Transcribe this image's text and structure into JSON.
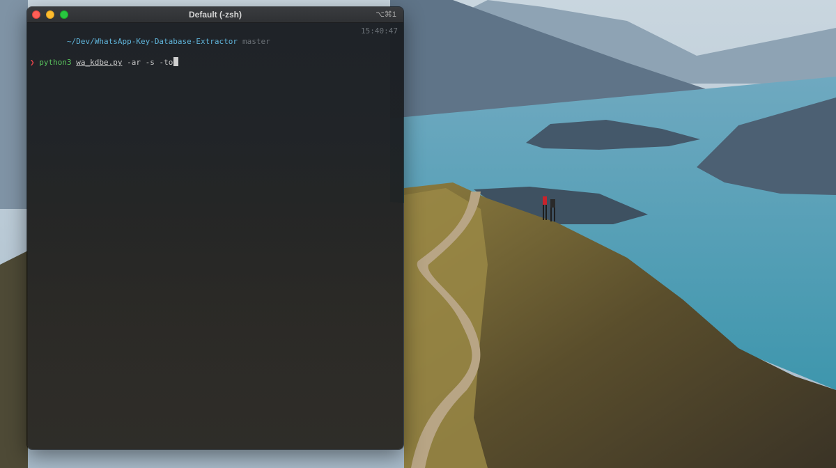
{
  "window": {
    "title": "Default (-zsh)",
    "shortcut": "⌥⌘1",
    "buttons": [
      "close",
      "minimize",
      "zoom"
    ]
  },
  "terminal": {
    "cwd": "~/Dev/WhatsApp-Key-Database-Extractor",
    "branch": "master",
    "time": "15:40:47",
    "prompt_symbol": "❯",
    "command": "python3",
    "script": "wa_kdbe.py",
    "args": "-ar -s -to"
  },
  "colors": {
    "path": "#5fb3d9",
    "prompt_symbol": "#e0444a",
    "command": "#59c25d",
    "muted": "#6b7177"
  }
}
